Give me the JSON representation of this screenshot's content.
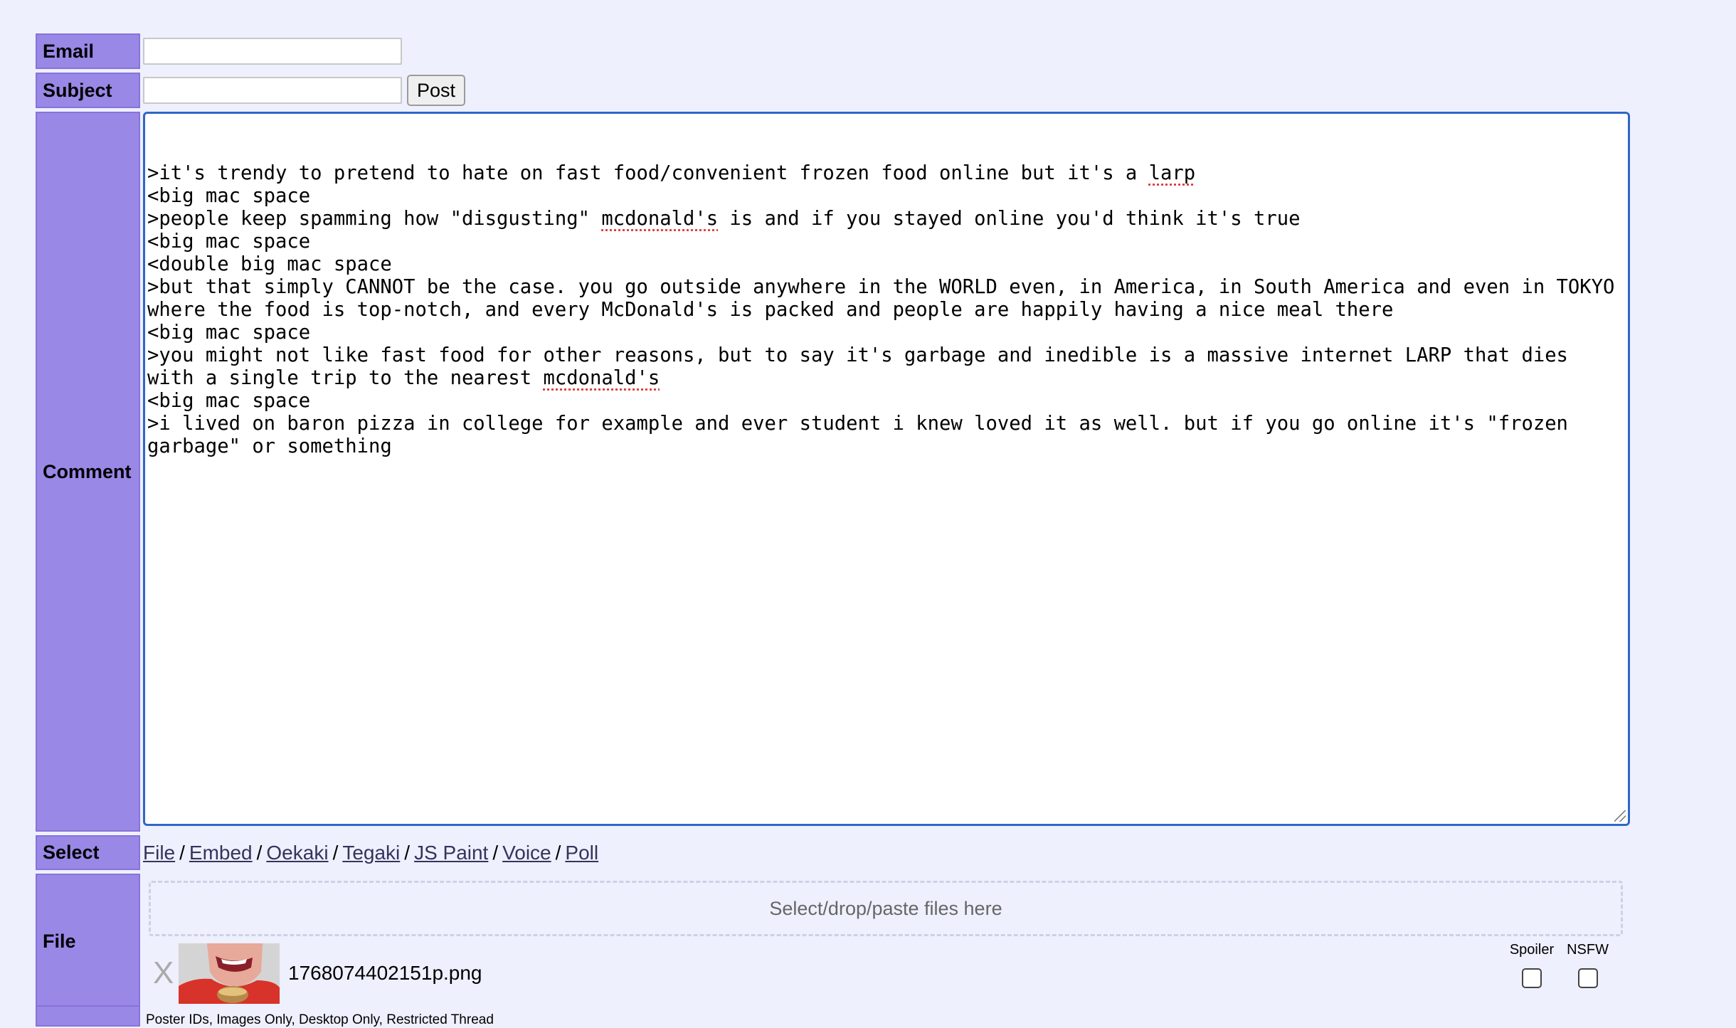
{
  "email": {
    "label": "Email",
    "value": ""
  },
  "subject": {
    "label": "Subject",
    "value": "",
    "post_button": "Post"
  },
  "comment": {
    "label": "Comment",
    "lines": [
      ">it's trendy to pretend to hate on fast food/convenient frozen food online but it's a larp",
      "<big mac space",
      ">people keep spamming how \"disgusting\" mcdonald's is and if you stayed online you'd think it's true",
      "<big mac space",
      "<double big mac space",
      ">but that simply CANNOT be the case. you go outside anywhere in the WORLD even, in America, in South America and even in TOKYO where the food is top-notch, and every McDonald's is packed and people are happily having a nice meal there",
      "<big mac space",
      ">you might not like fast food for other reasons, but to say it's garbage and inedible is a massive internet LARP that dies with a single trip to the nearest mcdonald's",
      "<big mac space",
      ">i lived on baron pizza in college for example and ever student i knew loved it as well. but if you go online it's \"frozen garbage\" or something"
    ]
  },
  "select": {
    "label": "Select",
    "options": [
      "File",
      "Embed",
      "Oekaki",
      "Tegaki",
      "JS Paint",
      "Voice",
      "Poll"
    ]
  },
  "file": {
    "label": "File",
    "dropzone_text": "Select/drop/paste files here",
    "remove_symbol": "X",
    "filename": "1768074402151p.png",
    "spoiler_label": "Spoiler",
    "nsfw_label": "NSFW"
  },
  "options_text": "Poster IDs, Images Only, Desktop Only, Restricted Thread"
}
